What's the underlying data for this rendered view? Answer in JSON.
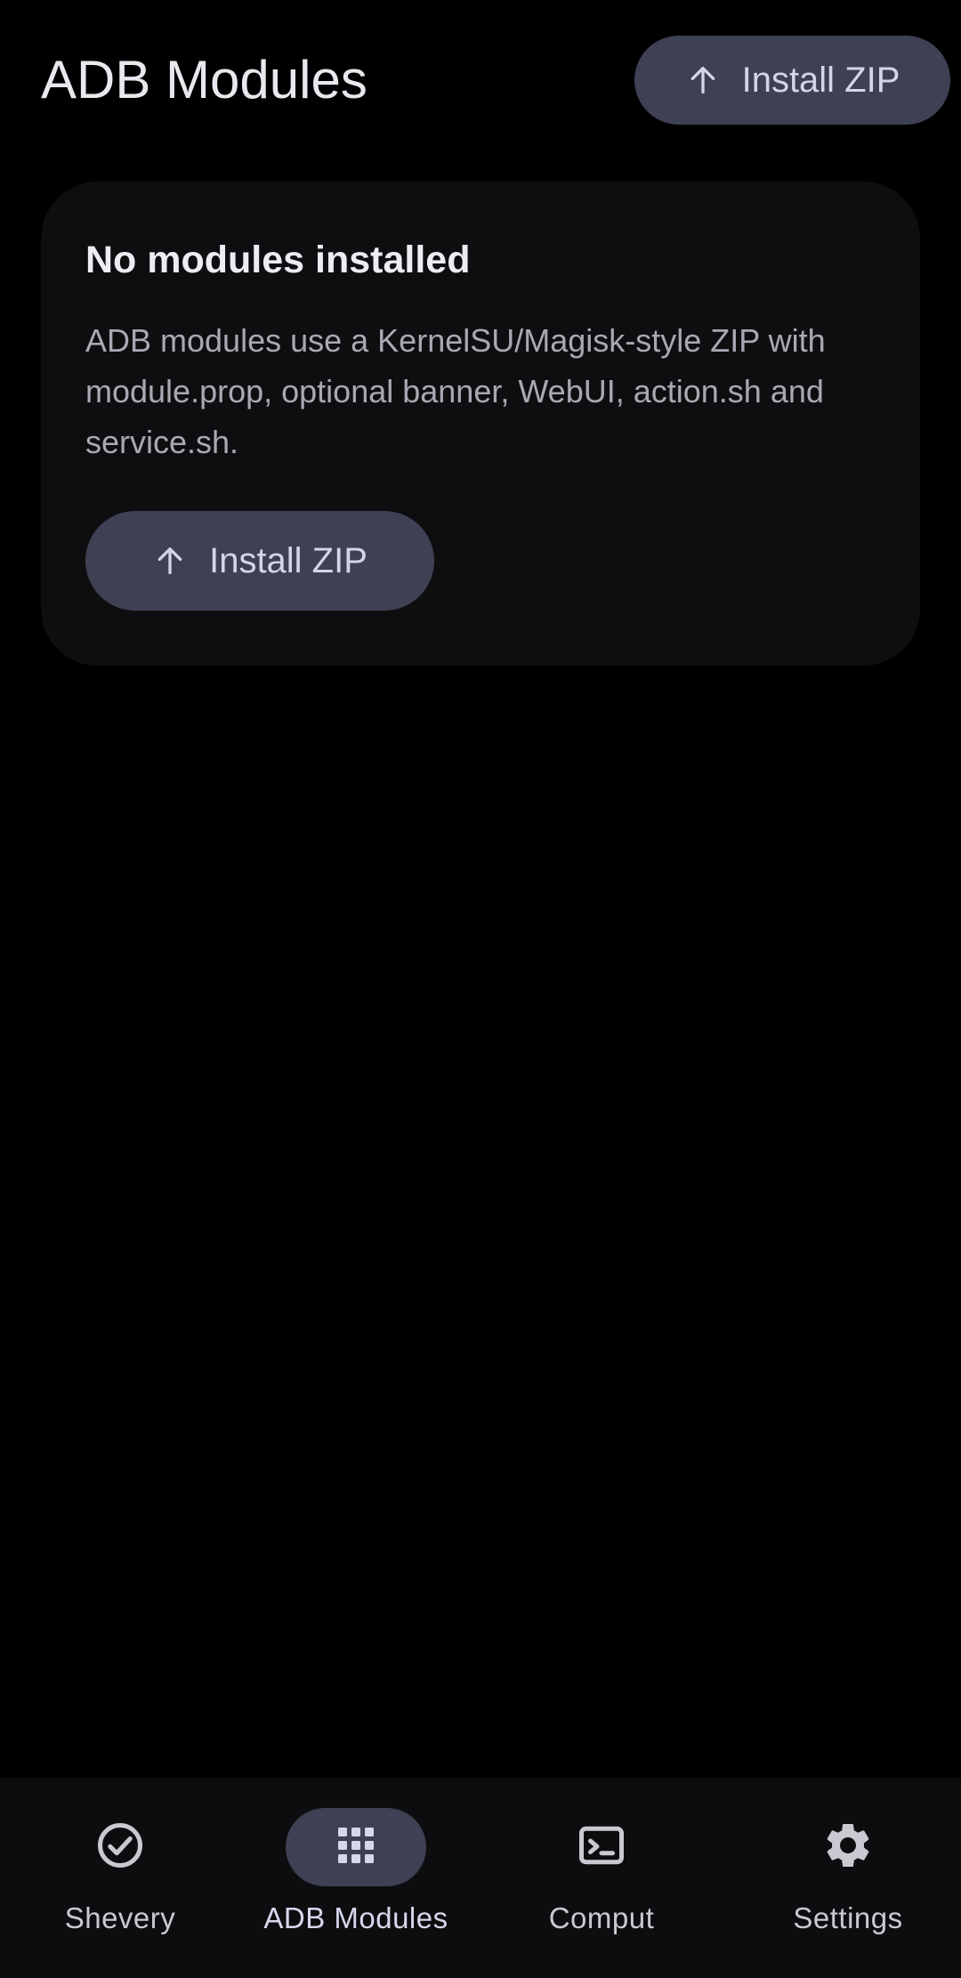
{
  "header": {
    "title": "ADB Modules",
    "install_label": "Install ZIP"
  },
  "empty_state": {
    "title": "No modules installed",
    "description": "ADB modules use a KernelSU/Magisk-style ZIP with module.prop, optional banner, WebUI, action.sh and service.sh.",
    "install_label": "Install ZIP"
  },
  "bottom_nav": {
    "active_index": 1,
    "items": [
      {
        "label": "Shevery",
        "icon": "check-circle-icon"
      },
      {
        "label": "ADB Modules",
        "icon": "grid-icon"
      },
      {
        "label": "Comput",
        "icon": "terminal-icon"
      },
      {
        "label": "Settings",
        "icon": "gear-icon"
      }
    ]
  },
  "colors": {
    "background": "#000000",
    "surface": "#0e0e10",
    "button": "#3e4054",
    "button_text": "#d4d5e6",
    "text_primary": "#e8e8ef",
    "text_secondary": "#a8a9b2"
  }
}
